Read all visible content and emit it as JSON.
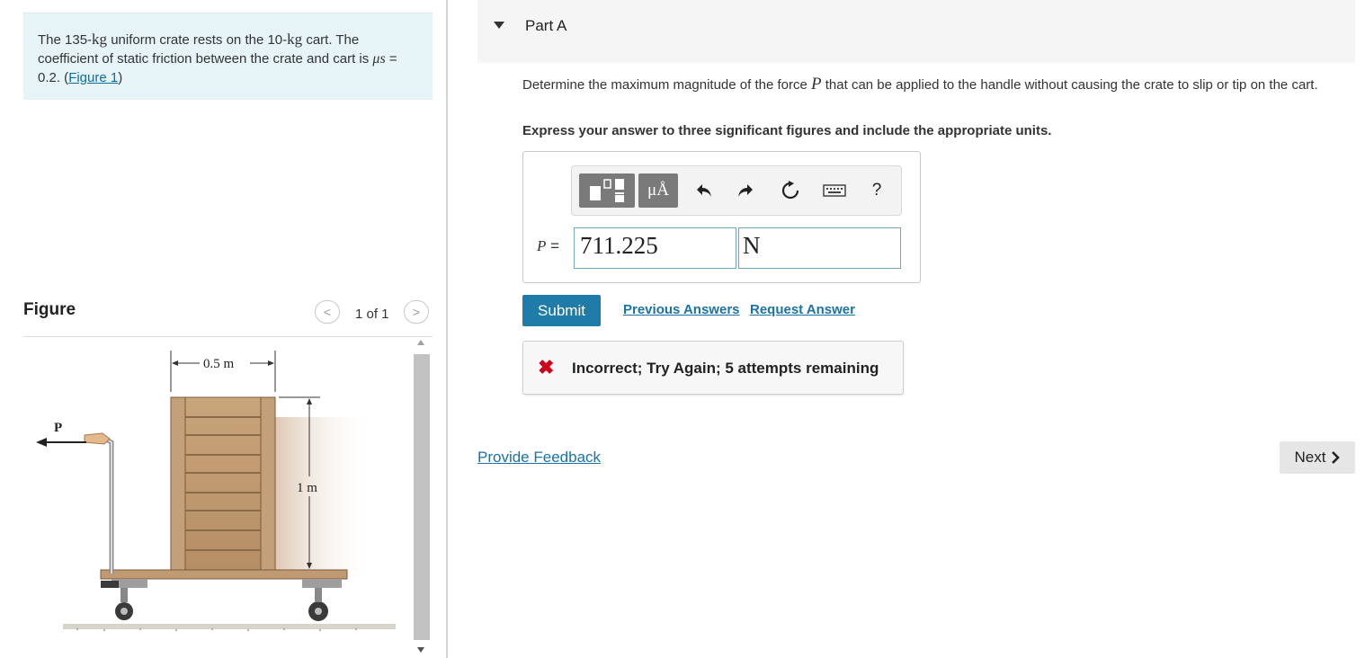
{
  "problem": {
    "crate_mass": "135-",
    "unit_kg": "kg",
    "text_1": " uniform crate rests on the ",
    "cart_mass": "10-",
    "text_2": " cart. The coefficient of static friction between the crate and cart is ",
    "mu_symbol": "μs",
    "mu_value": " = 0.2. (",
    "figure_link": "Figure 1",
    "close_paren": ")"
  },
  "figure": {
    "title": "Figure",
    "page_count": "1 of 1",
    "prev_label": "<",
    "next_label": ">",
    "labels": {
      "p": "P",
      "width": "0.5 m",
      "height": "1 m"
    }
  },
  "part": {
    "title": "Part A",
    "question_pre": "Determine the maximum magnitude of the force ",
    "question_symbol": "P",
    "question_post": " that can be applied to the handle without causing the crate to slip or tip on the cart.",
    "instruction": "Express your answer to three significant figures and include the appropriate units."
  },
  "toolbar": {
    "mu_button": "μÅ",
    "undo": "undo-icon",
    "redo": "redo-icon",
    "reset": "reset-icon",
    "keyboard": "keyboard-icon",
    "help": "?"
  },
  "answer": {
    "variable": "P",
    "equals": " =",
    "value": "711.225",
    "unit": "N"
  },
  "actions": {
    "submit": "Submit",
    "previous_answers": "Previous Answers",
    "request_answer": "Request Answer"
  },
  "feedback": {
    "icon": "✖",
    "message": "Incorrect; Try Again; 5 attempts remaining"
  },
  "footer": {
    "provide_feedback": "Provide Feedback",
    "next": "Next"
  },
  "colors": {
    "problem_bg": "#e6f4f7",
    "primary_button": "#1f7ca8",
    "link": "#1a73a3",
    "error": "#d0021b"
  }
}
